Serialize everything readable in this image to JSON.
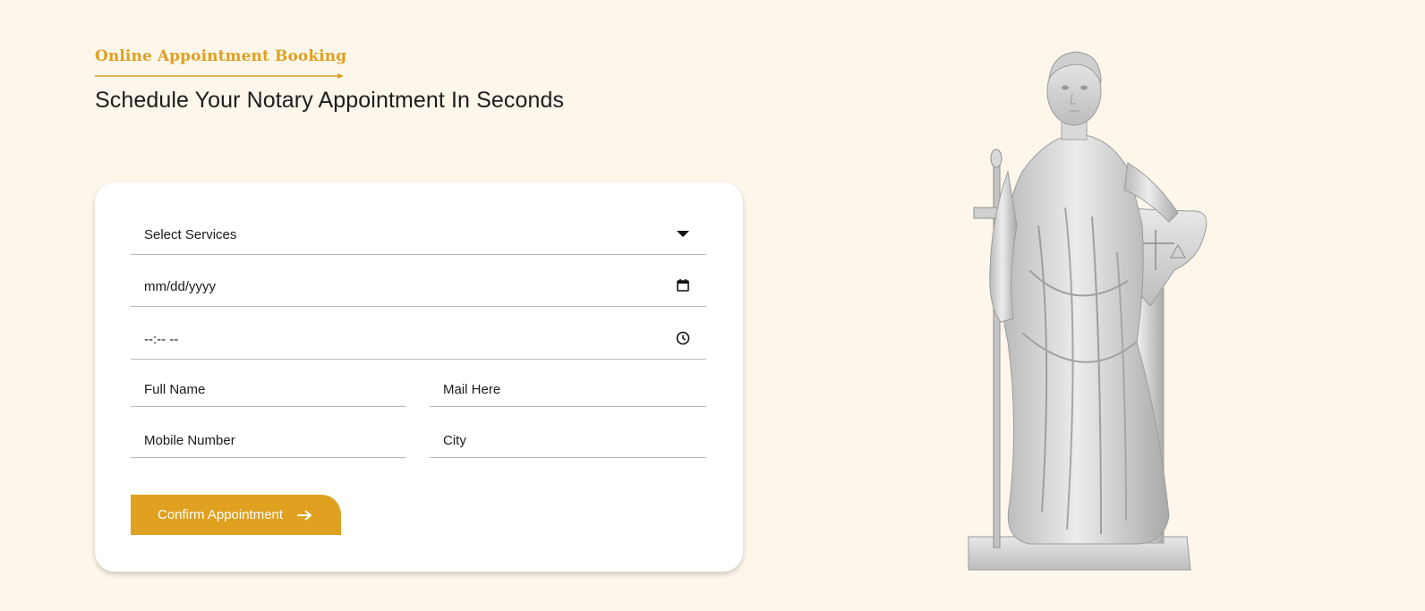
{
  "header": {
    "eyebrow": "Online Appointment Booking",
    "headline": "Schedule Your Notary Appointment In Seconds",
    "accent_color": "#e0a020"
  },
  "form": {
    "services_select": {
      "selected": "Select Services",
      "icon": "caret-down-icon"
    },
    "date_input": {
      "placeholder": "mm/dd/yyyy",
      "icon": "calendar-icon"
    },
    "time_input": {
      "placeholder": "--:-- --",
      "icon": "clock-icon"
    },
    "full_name": {
      "placeholder": "Full Name"
    },
    "email": {
      "placeholder": "Mail Here"
    },
    "mobile": {
      "placeholder": "Mobile Number"
    },
    "city": {
      "placeholder": "City"
    },
    "submit": {
      "label": "Confirm Appointment",
      "icon": "arrow-right-icon"
    }
  },
  "illustration": {
    "subject": "statue-of-lady-justice"
  }
}
